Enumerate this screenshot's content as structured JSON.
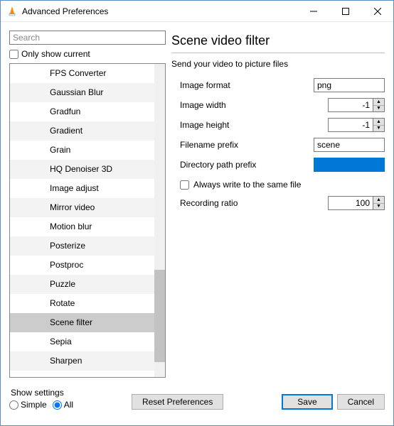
{
  "window": {
    "title": "Advanced Preferences"
  },
  "sidebar": {
    "search_placeholder": "Search",
    "only_current_label": "Only show current",
    "items": [
      {
        "label": "FPS Converter"
      },
      {
        "label": "Gaussian Blur"
      },
      {
        "label": "Gradfun"
      },
      {
        "label": "Gradient"
      },
      {
        "label": "Grain"
      },
      {
        "label": "HQ Denoiser 3D"
      },
      {
        "label": "Image adjust"
      },
      {
        "label": "Mirror video"
      },
      {
        "label": "Motion blur"
      },
      {
        "label": "Posterize"
      },
      {
        "label": "Postproc"
      },
      {
        "label": "Puzzle"
      },
      {
        "label": "Rotate"
      },
      {
        "label": "Scene filter"
      },
      {
        "label": "Sepia"
      },
      {
        "label": "Sharpen"
      }
    ],
    "selected_index": 13
  },
  "panel": {
    "title": "Scene video filter",
    "subtitle": "Send your video to picture files",
    "fields": {
      "image_format": {
        "label": "Image format",
        "value": "png"
      },
      "image_width": {
        "label": "Image width",
        "value": "-1"
      },
      "image_height": {
        "label": "Image height",
        "value": "-1"
      },
      "filename_prefix": {
        "label": "Filename prefix",
        "value": "scene"
      },
      "dir_prefix": {
        "label": "Directory path prefix",
        "value": ""
      },
      "always_write": {
        "label": "Always write to the same file",
        "checked": false
      },
      "recording_ratio": {
        "label": "Recording ratio",
        "value": "100"
      }
    }
  },
  "footer": {
    "show_label": "Show settings",
    "simple_label": "Simple",
    "all_label": "All",
    "reset_label": "Reset Preferences",
    "save_label": "Save",
    "cancel_label": "Cancel"
  }
}
